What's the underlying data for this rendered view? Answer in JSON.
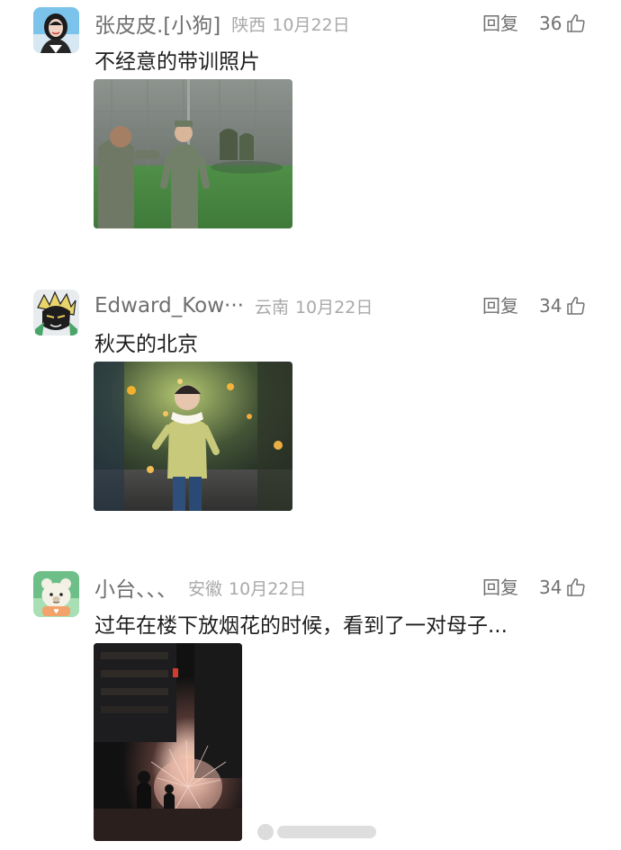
{
  "comments": [
    {
      "username": "张皮皮.[小狗]",
      "location": "陕西",
      "date": "10月22日",
      "reply_label": "回复",
      "likes": "36",
      "text": "不经意的带训照片",
      "avatar_icon": "girl-avatar",
      "photo_description_icon": "military-training-photo"
    },
    {
      "username": "Edward_Kow···",
      "location": "云南",
      "date": "10月22日",
      "reply_label": "回复",
      "likes": "34",
      "text": "秋天的北京",
      "avatar_icon": "anime-avatar",
      "photo_description_icon": "autumn-child-photo"
    },
    {
      "username": "小台、、、",
      "location": "安徽",
      "date": "10月22日",
      "reply_label": "回复",
      "likes": "34",
      "text": "过年在楼下放烟花的时候，看到了一对母子...",
      "avatar_icon": "bear-avatar",
      "photo_description_icon": "fireworks-photo"
    }
  ],
  "colors": {
    "username": "#6f6f6f",
    "meta": "#a9a9a9",
    "text": "#1e1e1e",
    "action": "#707070",
    "background": "#ffffff"
  }
}
